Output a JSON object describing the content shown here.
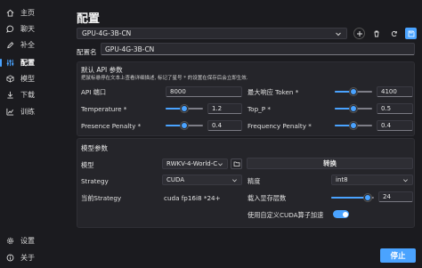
{
  "sidebar": {
    "items": [
      {
        "label": "主页",
        "icon": "home-icon"
      },
      {
        "label": "聊天",
        "icon": "chat-icon"
      },
      {
        "label": "补全",
        "icon": "pen-icon"
      },
      {
        "label": "配置",
        "icon": "config-icon",
        "active": true
      },
      {
        "label": "模型",
        "icon": "model-icon"
      },
      {
        "label": "下载",
        "icon": "download-icon"
      },
      {
        "label": "训练",
        "icon": "train-icon"
      }
    ],
    "bottom": [
      {
        "label": "设置",
        "icon": "gear-icon"
      },
      {
        "label": "关于",
        "icon": "info-icon"
      }
    ]
  },
  "page": {
    "title": "配置",
    "preset": "GPU-4G-3B-CN",
    "name_label": "配置名",
    "name_value": "GPU-4G-3B-CN"
  },
  "api": {
    "title": "默认 API 参数",
    "subtitle": "把鼠标悬停在文本上查看详细描述, 标记了星号 * 的设置在保存后会立即生效.",
    "port_label": "API 端口",
    "port_value": "8000",
    "max_tokens_label": "最大响应 Token *",
    "max_tokens_value": "4100",
    "max_tokens_fraction": 0.5,
    "temperature_label": "Temperature *",
    "temperature_value": "1.2",
    "temperature_fraction": 0.5,
    "top_p_label": "Top_P *",
    "top_p_value": "0.5",
    "top_p_fraction": 0.5,
    "presence_label": "Presence Penalty *",
    "presence_value": "0.4",
    "presence_fraction": 0.5,
    "frequency_label": "Frequency Penalty *",
    "frequency_value": "0.4",
    "frequency_fraction": 0.5
  },
  "model": {
    "title": "模型参数",
    "model_label": "模型",
    "model_value": "RWKV-4-World-C",
    "convert_label": "转换",
    "strategy_label": "Strategy",
    "strategy_value": "CUDA",
    "precision_label": "精度",
    "precision_value": "int8",
    "current_strategy_label": "当前Strategy",
    "current_strategy_value": "cuda fp16i8 *24+",
    "layers_label": "载入显存层数",
    "layers_value": "24",
    "layers_fraction": 0.85,
    "custom_cuda_label": "使用自定义CUDA算子加速",
    "custom_cuda_on": true
  },
  "footer": {
    "stop_label": "停止"
  },
  "colors": {
    "accent": "#4aa3ff",
    "background": "#1b1b1f",
    "card": "#25252a"
  }
}
